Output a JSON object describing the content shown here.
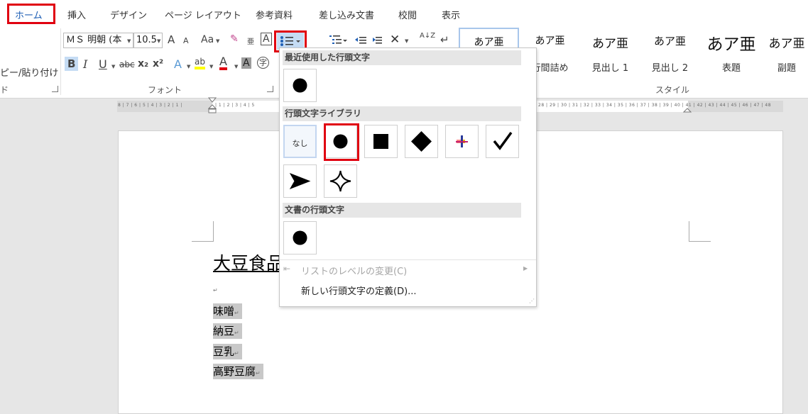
{
  "tabs": [
    "ホーム",
    "挿入",
    "デザイン",
    "ページ レイアウト",
    "参考資料",
    "差し込み文書",
    "校閲",
    "表示"
  ],
  "clipboard": {
    "paste_label": "ピー/貼り付け",
    "group_label": "ド"
  },
  "font": {
    "font_name": "ＭＳ 明朝 (本",
    "font_size": "10.5",
    "group_label": "フォント",
    "grow": "A",
    "shrink": "A",
    "case": "Aa",
    "bold": "B",
    "italic": "I",
    "underline": "U",
    "strike": "abc",
    "subscript": "x₂",
    "superscript": "x²",
    "text_effect": "A",
    "highlight": "ab",
    "font_color": "A",
    "shading": "A",
    "enclose": "字",
    "phonetic": "亜",
    "border_char": "A"
  },
  "paragraph": {
    "sort": "A↓Z",
    "show_marks": "↵"
  },
  "styles": {
    "group_label": "スタイル",
    "items": [
      {
        "preview": "あア亜",
        "name": ""
      },
      {
        "preview": "あア亜",
        "name": "行間詰め"
      },
      {
        "preview": "あア亜",
        "name": "見出し 1"
      },
      {
        "preview": "あア亜",
        "name": "見出し 2"
      },
      {
        "preview": "あア亜",
        "name": "表題"
      },
      {
        "preview": "あア亜",
        "name": "副題"
      }
    ]
  },
  "ruler": {
    "left_numbers": "8 | 7 | 6 | 5 | 4 | 3 | 2 | 1 |",
    "mid_numbers": "| 1 | 2 | 3 | 4 | 5",
    "right_numbers": "28 | 29 | 30 | 31 | 32 | 33 | 34 | 35 | 36 | 37 | 38 | 39 | 40 | 41 | 42 | 43 | 44 | 45 | 46 | 47 | 48"
  },
  "document": {
    "title": "大豆食品",
    "empty_mark": "↵",
    "items": [
      "味噌",
      "納豆",
      "豆乳",
      "高野豆腐"
    ],
    "para_mark": "↵"
  },
  "bullet_menu": {
    "recent_header": "最近使用した行頭文字",
    "library_header": "行頭文字ライブラリ",
    "document_header": "文書の行頭文字",
    "none_label": "なし",
    "library_icons": [
      "none-icon",
      "filled-circle-icon",
      "filled-square-icon",
      "filled-diamond-icon",
      "colored-plus-icon",
      "checkmark-icon",
      "arrowhead-icon",
      "four-point-star-icon"
    ],
    "change_level": "リストのレベルの変更(C)",
    "define_new": "新しい行頭文字の定義(D)..."
  },
  "colors": {
    "highlight_red": "#e00010",
    "accent_blue": "#1f5fb5",
    "selection_gray": "#c8c8c8"
  }
}
